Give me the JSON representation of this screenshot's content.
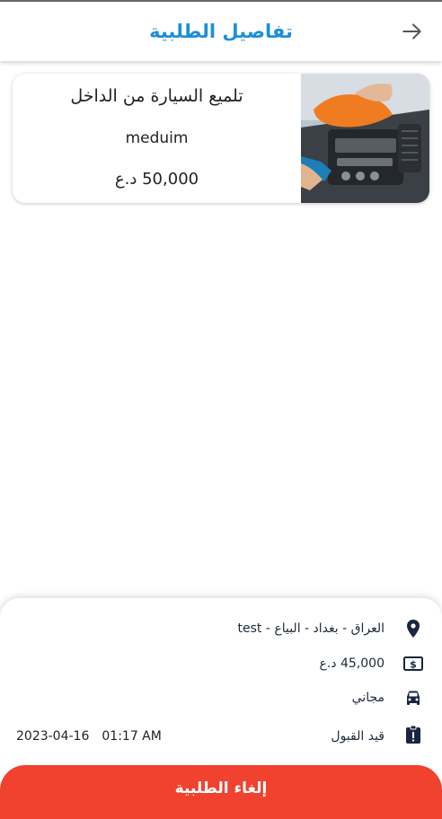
{
  "header": {
    "title": "تفاصيل الطلبية",
    "back_icon": "arrow-right-icon"
  },
  "service": {
    "name": "تلميع السيارة من الداخل",
    "size": "meduim",
    "price": "50,000 د.ع",
    "image": "car-interior-cleaning-photo"
  },
  "order": {
    "location": "العراق - بغداد - البياع -  test",
    "amount": "45,000 د.ع",
    "delivery": "مجاني",
    "status": "قيد القبول",
    "date": "2023-04-16",
    "time": "01:17 AM"
  },
  "actions": {
    "cancel_label": "إلغاء الطلبية"
  },
  "colors": {
    "accent": "#1d8fd8",
    "danger": "#f0422e",
    "icon": "#1a2540"
  }
}
